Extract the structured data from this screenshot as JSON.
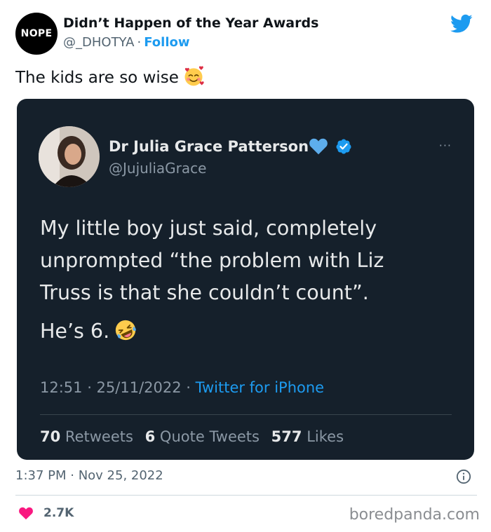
{
  "outer": {
    "avatar_text": "NOPE",
    "display_name": "Didn’t Happen of the Year Awards",
    "handle": "@_DHOTYA",
    "separator": "·",
    "follow_label": "Follow",
    "text": "The kids are so wise",
    "text_emoji": "smiling-face-with-hearts-icon",
    "time": "1:37 PM · Nov 25, 2022",
    "likes_count": "2.7K"
  },
  "embed": {
    "display_name": "Dr Julia Grace Patterson",
    "handle": "@JujuliaGrace",
    "more": "···",
    "text_lines": [
      "My little boy just said, completely",
      "unprompted “the problem with Liz",
      "Truss is that she couldn’t count”."
    ],
    "text_line2": "He’s 6.",
    "text_emoji": "rolling-on-floor-laughing-icon",
    "timestamp": "12:51 · 25/11/2022 · ",
    "source": "Twitter for iPhone",
    "stats": {
      "retweets_count": "70",
      "retweets_label": "Retweets",
      "quotes_count": "6",
      "quotes_label": "Quote Tweets",
      "likes_count": "577",
      "likes_label": "Likes"
    }
  },
  "watermark": "boredpanda.com",
  "colors": {
    "twitter_blue": "#1d9bf0",
    "dark_bg": "#15202b",
    "like_red": "#f91880"
  }
}
